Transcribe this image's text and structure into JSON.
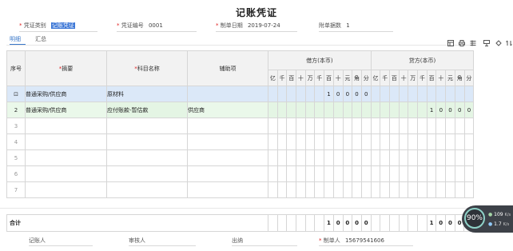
{
  "voucher": {
    "title": "记账凭证",
    "category_label": "凭证类别",
    "category_value": "记账凭证",
    "number_label": "凭证编号",
    "number_value": "0001",
    "date_label": "制单日期",
    "date_value": "2019-07-24",
    "attachments_label": "附单据数",
    "attachments_value": "1"
  },
  "tabs": [
    {
      "label": "明细",
      "active": true
    },
    {
      "label": "汇总",
      "active": false
    }
  ],
  "toolbar_icons": [
    "table-icon",
    "print-icon",
    "columns-icon",
    "layout-icon",
    "undo-icon",
    "settings-icon"
  ],
  "table": {
    "headers": {
      "index": "序号",
      "summary": "摘要",
      "account": "科目名称",
      "auxiliary": "辅助项",
      "debit": "借方(本币)",
      "credit": "贷方(本币)"
    },
    "digit_units": [
      "亿",
      "千",
      "百",
      "十",
      "万",
      "千",
      "百",
      "十",
      "元",
      "角",
      "分"
    ],
    "rows": [
      {
        "index": "⊡",
        "summary": "普通采购/供应商",
        "account": "原材料",
        "auxiliary": "",
        "debit": [
          "",
          "",
          "",
          "",
          "",
          "",
          "1",
          "0",
          "0",
          "0",
          "0"
        ],
        "credit": [
          "",
          "",
          "",
          "",
          "",
          "",
          "",
          "",
          "",
          "",
          ""
        ]
      },
      {
        "index": "2",
        "summary": "普通采购/供应商",
        "account": "应付账款-暂估款",
        "auxiliary": "供应商",
        "debit": [
          "",
          "",
          "",
          "",
          "",
          "",
          "",
          "",
          "",
          "",
          ""
        ],
        "credit": [
          "",
          "",
          "",
          "",
          "",
          "",
          "1",
          "0",
          "0",
          "0",
          "0"
        ]
      },
      {
        "index": "3",
        "summary": "",
        "account": "",
        "auxiliary": "",
        "debit": [
          "",
          "",
          "",
          "",
          "",
          "",
          "",
          "",
          "",
          "",
          ""
        ],
        "credit": [
          "",
          "",
          "",
          "",
          "",
          "",
          "",
          "",
          "",
          "",
          ""
        ]
      },
      {
        "index": "4",
        "summary": "",
        "account": "",
        "auxiliary": "",
        "debit": [
          "",
          "",
          "",
          "",
          "",
          "",
          "",
          "",
          "",
          "",
          ""
        ],
        "credit": [
          "",
          "",
          "",
          "",
          "",
          "",
          "",
          "",
          "",
          "",
          ""
        ]
      },
      {
        "index": "5",
        "summary": "",
        "account": "",
        "auxiliary": "",
        "debit": [
          "",
          "",
          "",
          "",
          "",
          "",
          "",
          "",
          "",
          "",
          ""
        ],
        "credit": [
          "",
          "",
          "",
          "",
          "",
          "",
          "",
          "",
          "",
          "",
          ""
        ]
      },
      {
        "index": "6",
        "summary": "",
        "account": "",
        "auxiliary": "",
        "debit": [
          "",
          "",
          "",
          "",
          "",
          "",
          "",
          "",
          "",
          "",
          ""
        ],
        "credit": [
          "",
          "",
          "",
          "",
          "",
          "",
          "",
          "",
          "",
          "",
          ""
        ]
      },
      {
        "index": "7",
        "summary": "",
        "account": "",
        "auxiliary": "",
        "debit": [
          "",
          "",
          "",
          "",
          "",
          "",
          "",
          "",
          "",
          "",
          ""
        ],
        "credit": [
          "",
          "",
          "",
          "",
          "",
          "",
          "",
          "",
          "",
          "",
          ""
        ]
      }
    ],
    "total_label": "合计",
    "total_debit": [
      "",
      "",
      "",
      "",
      "",
      "",
      "1",
      "0",
      "0",
      "0",
      "0"
    ],
    "total_credit": [
      "",
      "",
      "",
      "",
      "",
      "",
      "1",
      "0",
      "0",
      "0",
      "0"
    ]
  },
  "signatures": {
    "bookkeeper_label": "记账人",
    "auditor_label": "审核人",
    "cashier_label": "出纳",
    "preparer_label": "制单人",
    "preparer_value": "15679541606"
  },
  "monitor": {
    "cpu_percent": "90%",
    "upload": "109",
    "upload_unit": "K/s",
    "download": "1.7",
    "download_unit": "K/s"
  },
  "colors": {
    "accent": "#3a78c9",
    "selected_row": "#dbe8f8",
    "green_row": "#eaf8ea",
    "required": "#e02020"
  }
}
